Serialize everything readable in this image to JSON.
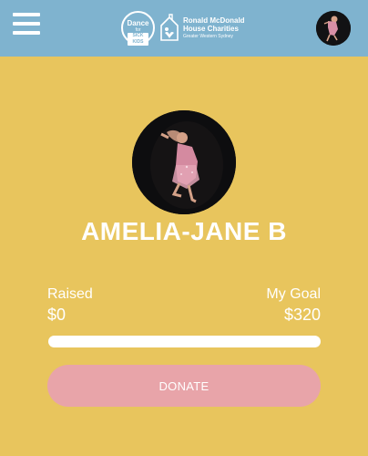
{
  "header": {
    "menu_icon": "hamburger-menu-icon",
    "dance_logo": {
      "line1": "Dance",
      "line2": "for",
      "line3": "SICK KIDS"
    },
    "rmhc_logo": {
      "icon": "rmhc-house-icon",
      "line1": "Ronald McDonald",
      "line2": "House Charities",
      "line3": "Greater Western Sydney"
    },
    "avatar": "user-avatar"
  },
  "profile": {
    "name": "AMELIA-JANE B"
  },
  "fundraising": {
    "raised_label": "Raised",
    "raised_value": "$0",
    "goal_label": "My Goal",
    "goal_value": "$320",
    "progress_fraction": 0
  },
  "donate_label": "DONATE",
  "colors": {
    "background": "#e8c55d",
    "header": "#7fb3cf",
    "donate_button": "#e8a4a9",
    "text": "#ffffff"
  }
}
